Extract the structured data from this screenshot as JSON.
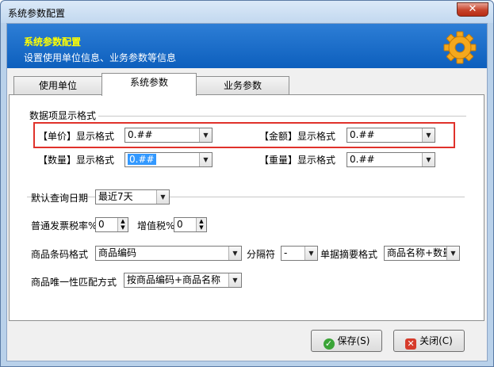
{
  "window": {
    "title": "系统参数配置",
    "close_glyph": "✕"
  },
  "banner": {
    "title": "系统参数配置",
    "subtitle": "设置使用单位信息、业务参数等信息",
    "icon": "gear-icon"
  },
  "tabs": [
    {
      "label": "使用单位",
      "active": false
    },
    {
      "label": "系统参数",
      "active": true
    },
    {
      "label": "业务参数",
      "active": false
    }
  ],
  "display_group": {
    "label": "数据项显示格式",
    "unit_price": {
      "label": "【单价】显示格式",
      "value": "0.##"
    },
    "amount": {
      "label": "【金额】显示格式",
      "value": "0.##"
    },
    "quantity": {
      "label": "【数量】显示格式",
      "value": "0.##"
    },
    "weight": {
      "label": "【重量】显示格式",
      "value": "0.##"
    }
  },
  "query_date": {
    "label": "默认查询日期",
    "value": "最近7天"
  },
  "tax": {
    "invoice_label": "普通发票税率%",
    "invoice_value": "0",
    "vat_label": "增值税%",
    "vat_value": "0"
  },
  "barcode": {
    "format_label": "商品条码格式",
    "format_value": "商品编码",
    "separator_label": "分隔符",
    "separator_value": "-",
    "summary_label": "单据摘要格式",
    "summary_value": "商品名称+数量"
  },
  "matching": {
    "label": "商品唯一性匹配方式",
    "value": "按商品编码+商品名称"
  },
  "buttons": {
    "save": "保存(S)",
    "close": "关闭(C)"
  },
  "colors": {
    "banner": "#1a6dc9",
    "banner_title": "#ffff00",
    "highlight": "#e0322b"
  }
}
